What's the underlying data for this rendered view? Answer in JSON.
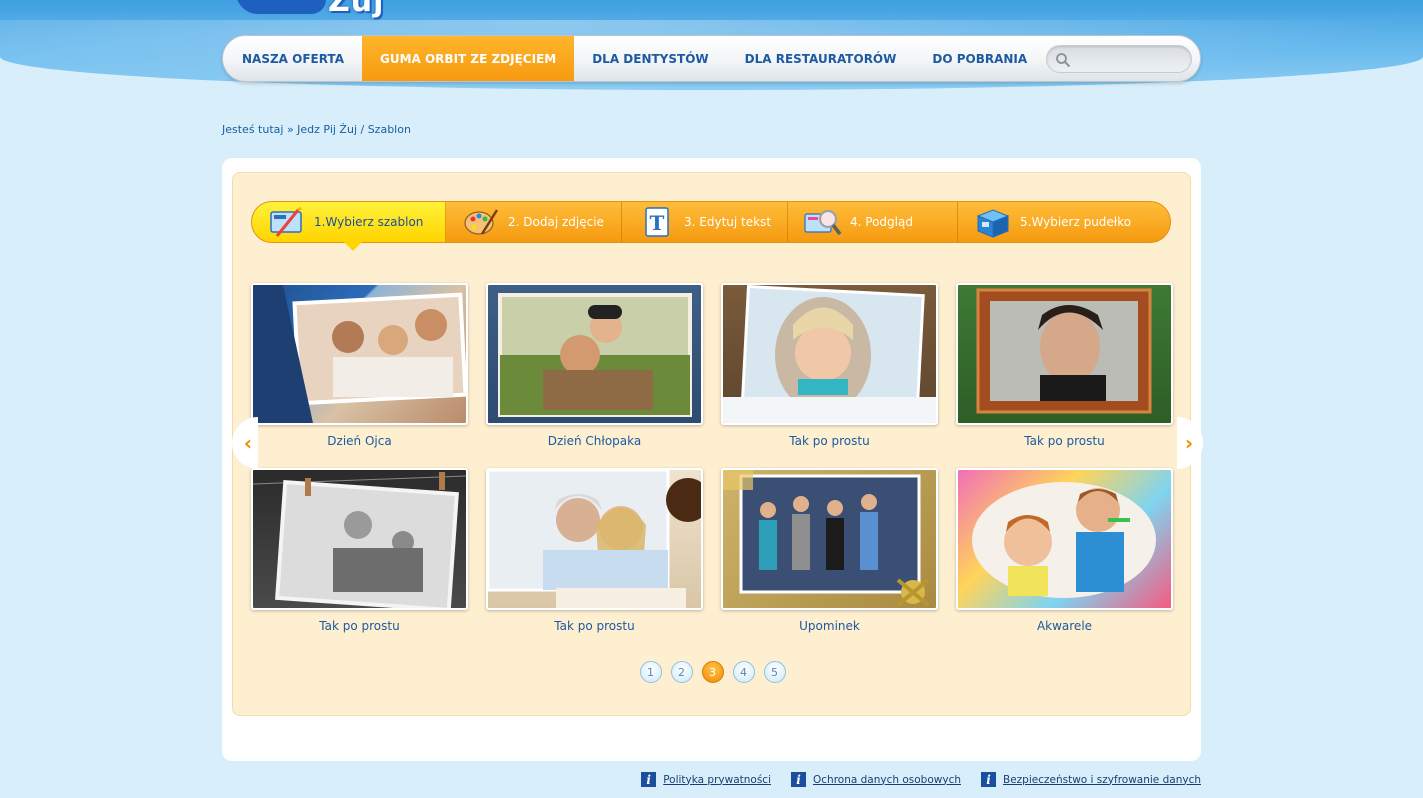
{
  "logo": {
    "text": "Żuj"
  },
  "nav": {
    "items": [
      {
        "label": "NASZA OFERTA",
        "active": false
      },
      {
        "label": "GUMA ORBIT ZE ZDJĘCIEM",
        "active": true
      },
      {
        "label": "DLA DENTYSTÓW",
        "active": false
      },
      {
        "label": "DLA RESTAURATORÓW",
        "active": false
      },
      {
        "label": "DO POBRANIA",
        "active": false
      }
    ],
    "search": {
      "value": "",
      "placeholder": ""
    }
  },
  "breadcrumb": "Jesteś tutaj » Jedz Pij Żuj / Szablon",
  "steps": [
    {
      "label": "1.Wybierz szablon",
      "icon": "template-pencil-icon",
      "active": true
    },
    {
      "label": "2. Dodaj zdjęcie",
      "icon": "paint-palette-icon",
      "active": false
    },
    {
      "label": "3. Edytuj tekst",
      "icon": "text-t-icon",
      "active": false
    },
    {
      "label": "4. Podgląd",
      "icon": "magnifier-preview-icon",
      "active": false
    },
    {
      "label": "5.Wybierz pudełko",
      "icon": "box-icon",
      "active": false
    }
  ],
  "templates": [
    {
      "caption": "Dzień Ojca"
    },
    {
      "caption": "Dzień Chłopaka"
    },
    {
      "caption": "Tak po prostu"
    },
    {
      "caption": "Tak po prostu"
    },
    {
      "caption": "Tak po prostu"
    },
    {
      "caption": "Tak po prostu"
    },
    {
      "caption": "Upominek"
    },
    {
      "caption": "Akwarele"
    }
  ],
  "arrows": {
    "prev": "‹",
    "next": "›"
  },
  "pagination": {
    "pages": [
      "1",
      "2",
      "3",
      "4",
      "5"
    ],
    "current": "3"
  },
  "footer": {
    "links": [
      "Polityka prywatności",
      "Ochrona danych osobowych",
      "Bezpieczeństwo i szyfrowanie danych"
    ]
  },
  "colors": {
    "accent_orange": "#f79a10",
    "active_yellow": "#ffd400",
    "link_blue": "#1d5aa2",
    "page_bg": "#d8eefb",
    "panel_cream": "#fdefd0"
  }
}
